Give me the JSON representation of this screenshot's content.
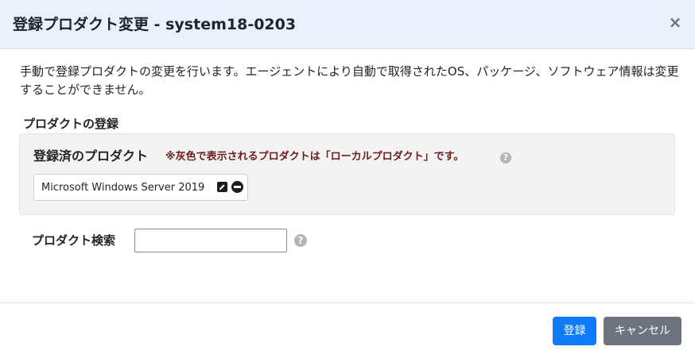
{
  "dialog": {
    "title": "登録プロダクト変更 - system18-0203",
    "close_label": "×"
  },
  "description": "手動で登録プロダクトの変更を行います。エージェントにより自動で取得されたOS、パッケージ、ソフトウェア情報は変更することができません。",
  "product_registration": {
    "section_title": "プロダクトの登録",
    "registered_label": "登録済のプロダクト",
    "local_note": "※灰色で表示されるプロダクトは「ローカルプロダクト」です。",
    "help_glyph": "?",
    "products": [
      {
        "name": "Microsoft Windows Server 2019"
      }
    ]
  },
  "search": {
    "label": "プロダクト検索",
    "value": "",
    "placeholder": "",
    "help_glyph": "?"
  },
  "footer": {
    "register_label": "登録",
    "cancel_label": "キャンセル"
  },
  "colors": {
    "header_bg": "#e8f1fc",
    "primary": "#0d7bf7",
    "secondary": "#6c757d",
    "note_text": "#6b1b1b",
    "box_bg": "#f3f3f3"
  },
  "icons": {
    "close": "close-icon",
    "help": "help-icon",
    "edit": "edit-icon",
    "remove": "remove-circle-icon"
  }
}
